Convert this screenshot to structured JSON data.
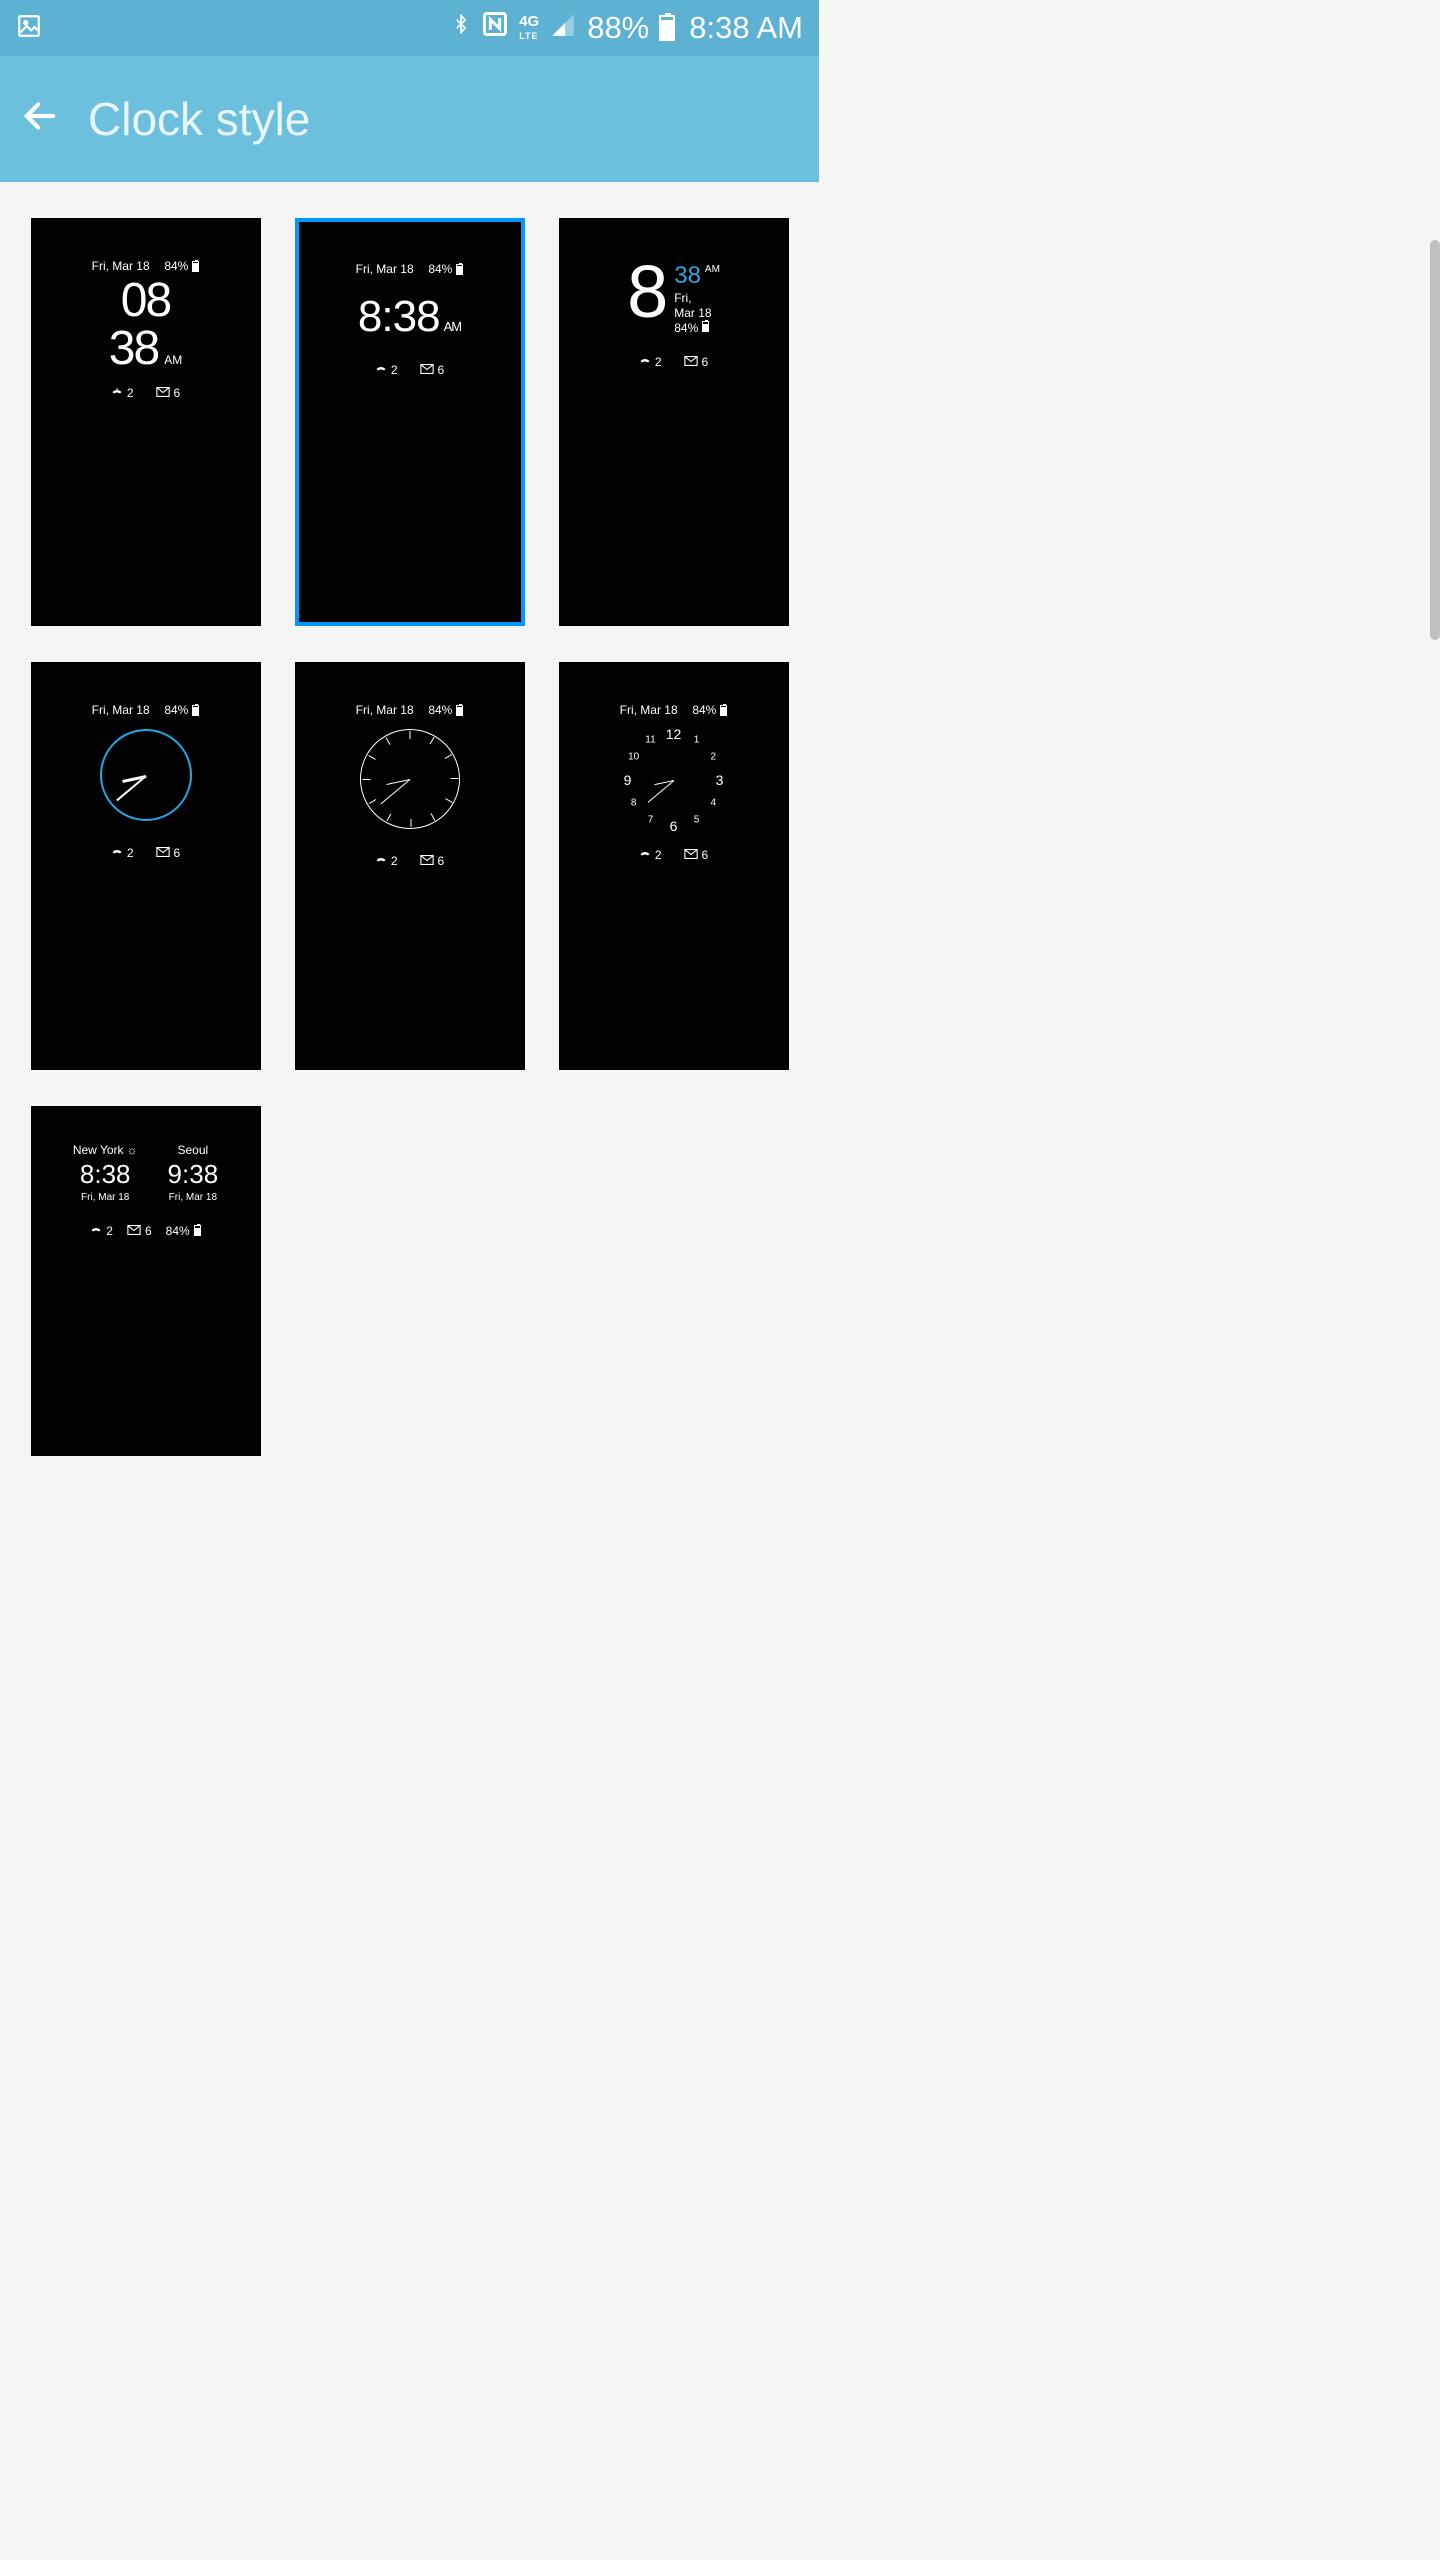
{
  "status": {
    "battery_pct": "88%",
    "time": "8:38 AM",
    "network_label": "4G LTE"
  },
  "header": {
    "title": "Clock style"
  },
  "common": {
    "dateline": "Fri, Mar 18",
    "battery": "84%",
    "missed": "2",
    "mail": "6"
  },
  "tiles": {
    "t1": {
      "hours": "08",
      "minutes": "38",
      "ampm": "AM"
    },
    "t2": {
      "time": "8:38",
      "ampm": "AM"
    },
    "t3": {
      "hours": "8",
      "minutes": "38",
      "ampm": "AM",
      "day": "Fri,",
      "date": "Mar 18",
      "batt": "84%"
    },
    "t7": {
      "city1": "New York",
      "time1": "8:38",
      "date1": "Fri, Mar 18",
      "city2": "Seoul",
      "time2": "9:38",
      "date2": "Fri, Mar 18"
    }
  },
  "selected_index": 1
}
